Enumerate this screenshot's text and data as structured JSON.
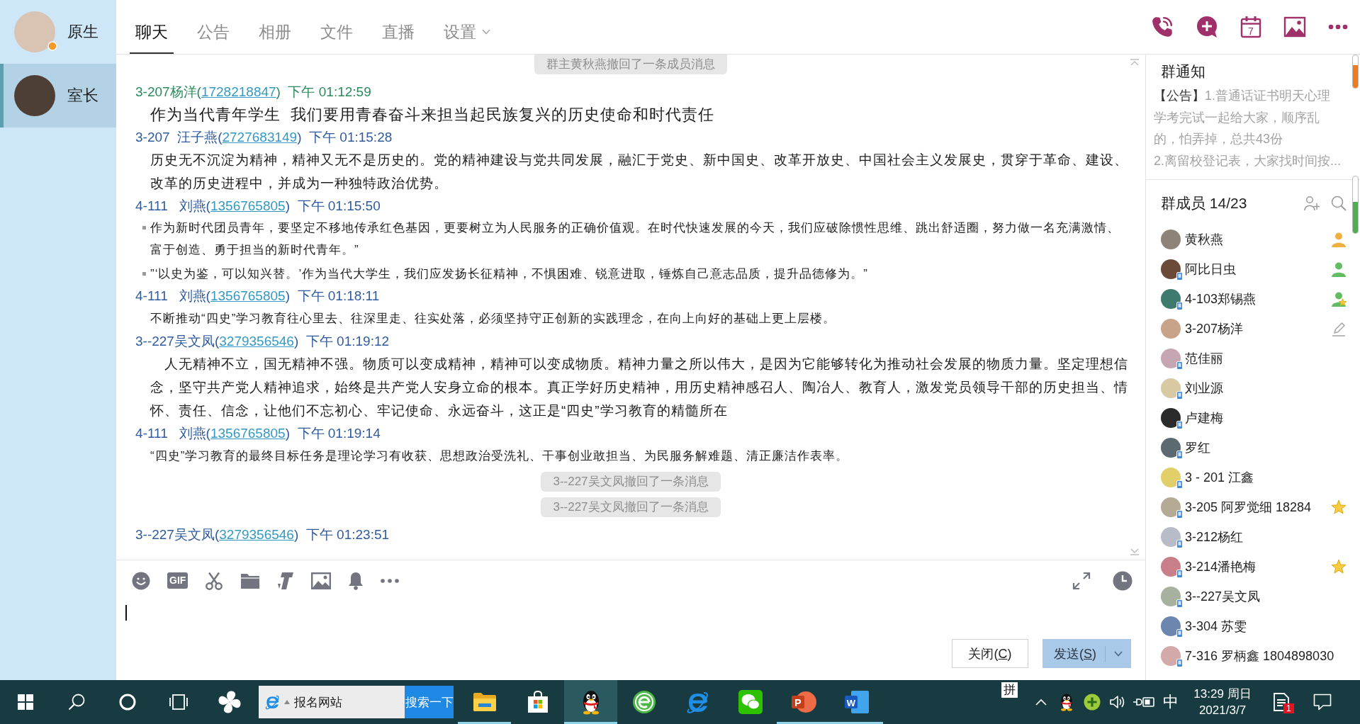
{
  "sidebar": {
    "items": [
      {
        "name": "原生",
        "selected": false,
        "badge": true
      },
      {
        "name": "室长",
        "selected": true,
        "badge": false
      }
    ]
  },
  "tabs": [
    {
      "label": "聊天",
      "selected": true,
      "dropdown": false
    },
    {
      "label": "公告",
      "selected": false,
      "dropdown": false
    },
    {
      "label": "相册",
      "selected": false,
      "dropdown": false
    },
    {
      "label": "文件",
      "selected": false,
      "dropdown": false
    },
    {
      "label": "直播",
      "selected": false,
      "dropdown": false
    },
    {
      "label": "设置",
      "selected": false,
      "dropdown": true
    }
  ],
  "header_icons": {
    "calendar_day": "7"
  },
  "chat": {
    "items": [
      {
        "kind": "notice",
        "text": "群主黄秋燕撤回了一条成员消息"
      },
      {
        "kind": "message",
        "self": true,
        "head": "3-207杨洋(",
        "qq": "1728218847",
        "tail": ")  下午 01:12:59",
        "paragraphs": [
          {
            "kind": "headline",
            "text": "作为当代青年学生  我们要用青春奋斗来担当起民族复兴的历史使命和时代责任"
          }
        ]
      },
      {
        "kind": "message",
        "self": false,
        "head": "3-207  汪子燕(",
        "qq": "2727683149",
        "tail": ")  下午 01:15:28",
        "paragraphs": [
          {
            "kind": "text",
            "text": "历史无不沉淀为精神，精神又无不是历史的。党的精神建设与党共同发展，融汇于党史、新中国史、改革开放史、中国社会主义发展史，贯穿于革命、建设、改革的历史进程中，并成为一种独特政治优势。"
          }
        ]
      },
      {
        "kind": "message",
        "self": false,
        "head": "4-111   刘燕(",
        "qq": "1356765805",
        "tail": ")  下午 01:15:50",
        "paragraphs": [
          {
            "kind": "bullet",
            "text": "作为新时代团员青年，要坚定不移地传承红色基因，更要树立为人民服务的正确价值观。在时代快速发展的今天，我们应破除惯性思维、跳出舒适圈，努力做一名充满激情、富于创造、勇于担当的新时代青年。”"
          },
          {
            "kind": "bullet",
            "text": "”‘以史为鉴，可以知兴替。’作为当代大学生，我们应发扬长征精神，不惧困难、锐意进取，锤炼自己意志品质，提升品德修为。”"
          }
        ]
      },
      {
        "kind": "message",
        "self": false,
        "head": "4-111   刘燕(",
        "qq": "1356765805",
        "tail": ")  下午 01:18:11",
        "paragraphs": [
          {
            "kind": "small",
            "text": "不断推动“四史”学习教育往心里去、往深里走、往实处落，必须坚持守正创新的实践理念，在向上向好的基础上更上层楼。"
          }
        ]
      },
      {
        "kind": "message",
        "self": false,
        "head": "3--227吴文凤(",
        "qq": "3279356546",
        "tail": ")  下午 01:19:12",
        "paragraphs": [
          {
            "kind": "text",
            "text": "　人无精神不立，国无精神不强。物质可以变成精神，精神可以变成物质。精神力量之所以伟大，是因为它能够转化为推动社会发展的物质力量。坚定理想信念，坚守共产党人精神追求，始终是共产党人安身立命的根本。真正学好历史精神，用历史精神感召人、陶冶人、教育人，激发党员领导干部的历史担当、情怀、责任、信念，让他们不忘初心、牢记使命、永远奋斗，这正是“四史”学习教育的精髓所在"
          }
        ]
      },
      {
        "kind": "message",
        "self": false,
        "head": "4-111   刘燕(",
        "qq": "1356765805",
        "tail": ")  下午 01:19:14",
        "paragraphs": [
          {
            "kind": "small",
            "text": "“四史”学习教育的最终目标任务是理论学习有收获、思想政治受洗礼、干事创业敢担当、为民服务解难题、清正廉洁作表率。"
          }
        ]
      },
      {
        "kind": "notice",
        "text": "3--227吴文凤撤回了一条消息"
      },
      {
        "kind": "notice",
        "text": "3--227吴文凤撤回了一条消息"
      },
      {
        "kind": "message",
        "self": false,
        "head": "3--227吴文凤(",
        "qq": "3279356546",
        "tail": ")  下午 01:23:51"
      }
    ]
  },
  "composer": {
    "gif_label": "GIF",
    "buttons": [
      {
        "kind": "close",
        "text": "关闭(",
        "hotkey": "C",
        "text_end": ")",
        "dropdown": false
      },
      {
        "kind": "send",
        "text": "发送(",
        "hotkey": "S",
        "text_end": ")",
        "dropdown": true
      }
    ]
  },
  "notice": {
    "title": "群通知",
    "tag": "【公告】",
    "text": "1.普通话证书明天心理学考完试一起给大家，顺序乱的，怕弄掉，总共43份",
    "more": "2.离留校登记表，大家找时间按..."
  },
  "members": {
    "title": "群成员 14/23",
    "list": [
      {
        "name": "黄秋燕",
        "mobile": false,
        "kind": "owner"
      },
      {
        "name": "阿比日虫",
        "mobile": true,
        "kind": "admin"
      },
      {
        "name": "4-103郑锡燕",
        "mobile": true,
        "kind": "admin-star"
      },
      {
        "name": "3-207杨洋",
        "mobile": false,
        "kind": "self"
      },
      {
        "name": "范佳丽",
        "mobile": true,
        "kind": "member"
      },
      {
        "name": "刘业源",
        "mobile": true,
        "kind": "member"
      },
      {
        "name": "卢建梅",
        "mobile": true,
        "kind": "member"
      },
      {
        "name": "罗红",
        "mobile": true,
        "kind": "member"
      },
      {
        "name": "3 - 201 江鑫",
        "mobile": true,
        "kind": "member"
      },
      {
        "name": "3-205 阿罗觉细 18284",
        "mobile": true,
        "kind": "starred"
      },
      {
        "name": "3-212杨红",
        "mobile": true,
        "kind": "member"
      },
      {
        "name": "3-214潘艳梅",
        "mobile": true,
        "kind": "starred"
      },
      {
        "name": "3--227吴文凤",
        "mobile": true,
        "kind": "member"
      },
      {
        "name": "3-304 苏雯",
        "mobile": true,
        "kind": "member"
      },
      {
        "name": "7-316 罗柄鑫 1804898030",
        "mobile": true,
        "kind": "member"
      }
    ]
  },
  "taskbar": {
    "search_box": {
      "value": "报名网站",
      "button": "搜索一下"
    },
    "apps": [
      {
        "kind": "explorer",
        "running": true,
        "selected": false
      },
      {
        "kind": "store",
        "running": false,
        "selected": false
      },
      {
        "kind": "qq",
        "running": true,
        "selected": true
      },
      {
        "kind": "browser-360",
        "running": false,
        "selected": false
      },
      {
        "kind": "ie",
        "running": false,
        "selected": false
      },
      {
        "kind": "wechat",
        "running": false,
        "selected": false
      },
      {
        "kind": "powerpoint",
        "letter": "P",
        "running": true,
        "selected": false
      },
      {
        "kind": "word",
        "letter": "W",
        "running": true,
        "selected": false
      }
    ],
    "ime_mode": "拼",
    "input_lang": "中",
    "clock": {
      "time": "13:29 周日",
      "date": "2021/3/7"
    },
    "notification_count": "1"
  }
}
